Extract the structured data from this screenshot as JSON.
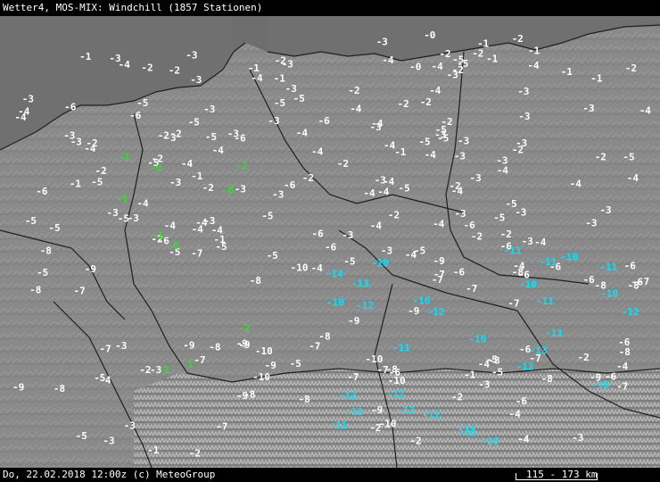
{
  "header": {
    "title": "Wetter4, MOS-MIX: Windchill (1857 Stationen)"
  },
  "footer": {
    "timestamp": "Do, 22.02.2018 12:00z (c) MeteoGroup",
    "scale": "115 - 173 km"
  },
  "colors": {
    "default_value": "#ffffff",
    "cyan_value": "#00e5ff",
    "green_value": "#33dd33",
    "land": "#8a8a8a",
    "sea": "#6e6e6e",
    "border": "#222222"
  },
  "stations_note_free": true,
  "stations": [
    {
      "v": "-0",
      "c": "w"
    },
    {
      "v": "-0",
      "c": "w"
    },
    {
      "v": "-2",
      "c": "w"
    },
    {
      "v": "-4",
      "c": "w"
    },
    {
      "v": "-5",
      "c": "w"
    },
    {
      "v": "-1",
      "c": "w"
    },
    {
      "v": "-2",
      "c": "w"
    },
    {
      "v": "-3",
      "c": "w"
    },
    {
      "v": "-2",
      "c": "w"
    },
    {
      "v": "-1",
      "c": "w"
    },
    {
      "v": "-1",
      "c": "w"
    },
    {
      "v": "-2",
      "c": "w"
    },
    {
      "v": "-3",
      "c": "w"
    },
    {
      "v": "-1",
      "c": "w"
    },
    {
      "v": "-2",
      "c": "w"
    },
    {
      "v": "-1",
      "c": "w"
    },
    {
      "v": "-3",
      "c": "w"
    },
    {
      "v": "-1",
      "c": "w"
    },
    {
      "v": "-2",
      "c": "w"
    },
    {
      "v": "-1",
      "c": "w"
    },
    {
      "v": "-3",
      "c": "w"
    },
    {
      "v": "-4",
      "c": "w"
    },
    {
      "v": "-2",
      "c": "w"
    },
    {
      "v": "-5",
      "c": "w"
    },
    {
      "v": "-4",
      "c": "w"
    },
    {
      "v": "-3",
      "c": "w"
    },
    {
      "v": "-2",
      "c": "w"
    },
    {
      "v": "-4",
      "c": "w"
    },
    {
      "v": "-5",
      "c": "w"
    },
    {
      "v": "-3",
      "c": "w"
    },
    {
      "v": "-2",
      "c": "w"
    },
    {
      "v": "-4",
      "c": "w"
    },
    {
      "v": "-3",
      "c": "w"
    },
    {
      "v": "-1",
      "c": "w"
    },
    {
      "v": "-3",
      "c": "w"
    },
    {
      "v": "-4",
      "c": "w"
    },
    {
      "v": "-2",
      "c": "w"
    },
    {
      "v": "-3",
      "c": "w"
    },
    {
      "v": "-5",
      "c": "w"
    },
    {
      "v": "-4",
      "c": "w"
    },
    {
      "v": "-6",
      "c": "w"
    },
    {
      "v": "-5",
      "c": "w"
    },
    {
      "v": "-3",
      "c": "w"
    },
    {
      "v": "-4",
      "c": "w"
    },
    {
      "v": "-2",
      "c": "w"
    },
    {
      "v": "-3",
      "c": "w"
    },
    {
      "v": "-5",
      "c": "w"
    },
    {
      "v": "-4",
      "c": "w"
    },
    {
      "v": "-6",
      "c": "w"
    },
    {
      "v": "-5",
      "c": "w"
    },
    {
      "v": "-4",
      "c": "w"
    },
    {
      "v": "-3",
      "c": "w"
    },
    {
      "v": "-6",
      "c": "w"
    },
    {
      "v": "-4",
      "c": "w"
    },
    {
      "v": "-5",
      "c": "w"
    },
    {
      "v": "-2",
      "c": "w"
    },
    {
      "v": "-3",
      "c": "w"
    },
    {
      "v": "-4",
      "c": "w"
    },
    {
      "v": "-3",
      "c": "w"
    },
    {
      "v": "-2",
      "c": "w"
    },
    {
      "v": "-4",
      "c": "w"
    },
    {
      "v": "-3",
      "c": "w"
    },
    {
      "v": "-2",
      "c": "w"
    },
    {
      "v": "-5",
      "c": "w"
    },
    {
      "v": "-3",
      "c": "w"
    },
    {
      "v": "-4",
      "c": "w"
    },
    {
      "v": "-2",
      "c": "w"
    },
    {
      "v": "-3",
      "c": "w"
    },
    {
      "v": "-5",
      "c": "w"
    },
    {
      "v": "-4",
      "c": "w"
    },
    {
      "v": "-6",
      "c": "w"
    },
    {
      "v": "-3",
      "c": "w"
    },
    {
      "v": "-4",
      "c": "w"
    },
    {
      "v": "-5",
      "c": "w"
    },
    {
      "v": "-2",
      "c": "w"
    },
    {
      "v": "-3",
      "c": "w"
    },
    {
      "v": "-4",
      "c": "w"
    },
    {
      "v": "-2",
      "c": "w"
    },
    {
      "v": "-3",
      "c": "w"
    },
    {
      "v": "-1",
      "c": "w"
    },
    {
      "v": "-3",
      "c": "w"
    },
    {
      "v": "-2",
      "c": "w"
    },
    {
      "v": "-4",
      "c": "w"
    },
    {
      "v": "-3",
      "c": "w"
    },
    {
      "v": "-5",
      "c": "w"
    },
    {
      "v": "-2",
      "c": "w"
    },
    {
      "v": "-1",
      "c": "w"
    },
    {
      "v": "-3",
      "c": "w"
    },
    {
      "v": "-2",
      "c": "w"
    },
    {
      "v": "-4",
      "c": "w"
    },
    {
      "v": "-3",
      "c": "w"
    },
    {
      "v": "-2",
      "c": "w"
    },
    {
      "v": "-1",
      "c": "w"
    },
    {
      "v": "-3",
      "c": "w"
    },
    {
      "v": "-2",
      "c": "w"
    },
    {
      "v": "-4",
      "c": "w"
    },
    {
      "v": "-3",
      "c": "w"
    },
    {
      "v": "-5",
      "c": "w"
    },
    {
      "v": "-2",
      "c": "w"
    },
    {
      "v": "-4",
      "c": "w"
    },
    {
      "v": "-3",
      "c": "w"
    },
    {
      "v": "-6",
      "c": "w"
    },
    {
      "v": "-4",
      "c": "w"
    },
    {
      "v": "-3",
      "c": "w"
    },
    {
      "v": "-5",
      "c": "w"
    },
    {
      "v": "-4",
      "c": "w"
    },
    {
      "v": "-6",
      "c": "w"
    },
    {
      "v": "-5",
      "c": "w"
    },
    {
      "v": "-4",
      "c": "w"
    },
    {
      "v": "-3",
      "c": "w"
    },
    {
      "v": "-5",
      "c": "w"
    },
    {
      "v": "-4",
      "c": "w"
    },
    {
      "v": "-6",
      "c": "w"
    },
    {
      "v": "-5",
      "c": "w"
    },
    {
      "v": "-4",
      "c": "w"
    },
    {
      "v": "-3",
      "c": "w"
    },
    {
      "v": "-2",
      "c": "w"
    },
    {
      "v": "-4",
      "c": "w"
    },
    {
      "v": "-3",
      "c": "w"
    },
    {
      "v": "-5",
      "c": "w"
    },
    {
      "v": "-4",
      "c": "w"
    },
    {
      "v": "-2",
      "c": "w"
    },
    {
      "v": "-3",
      "c": "w"
    },
    {
      "v": "-4",
      "c": "w"
    },
    {
      "v": "-2",
      "c": "w"
    },
    {
      "v": "-3",
      "c": "w"
    },
    {
      "v": "-1",
      "c": "w"
    },
    {
      "v": "-2",
      "c": "w"
    },
    {
      "v": "-3",
      "c": "w"
    },
    {
      "v": "-4",
      "c": "w"
    },
    {
      "v": "-5",
      "c": "w"
    },
    {
      "v": "-3",
      "c": "w"
    },
    {
      "v": "-4",
      "c": "w"
    },
    {
      "v": "-6",
      "c": "w"
    },
    {
      "v": "-5",
      "c": "w"
    },
    {
      "v": "-4",
      "c": "w"
    },
    {
      "v": "-3",
      "c": "w"
    },
    {
      "v": "-5",
      "c": "w"
    },
    {
      "v": "-6",
      "c": "w"
    },
    {
      "v": "-4",
      "c": "w"
    },
    {
      "v": "-3",
      "c": "w"
    },
    {
      "v": "-5",
      "c": "w"
    },
    {
      "v": "-4",
      "c": "w"
    },
    {
      "v": "-3",
      "c": "w"
    },
    {
      "v": "-6",
      "c": "w"
    },
    {
      "v": "-5",
      "c": "w"
    },
    {
      "v": "-4",
      "c": "w"
    },
    {
      "v": "-6",
      "c": "w"
    },
    {
      "v": "-7",
      "c": "w"
    },
    {
      "v": "-5",
      "c": "w"
    },
    {
      "v": "-6",
      "c": "w"
    },
    {
      "v": "-4",
      "c": "w"
    },
    {
      "v": "-5",
      "c": "w"
    },
    {
      "v": "-6",
      "c": "w"
    },
    {
      "v": "-7",
      "c": "w"
    },
    {
      "v": "-8",
      "c": "w"
    },
    {
      "v": "-6",
      "c": "w"
    },
    {
      "v": "-5",
      "c": "w"
    },
    {
      "v": "-7",
      "c": "w"
    },
    {
      "v": "-6",
      "c": "w"
    },
    {
      "v": "-8",
      "c": "w"
    },
    {
      "v": "-7",
      "c": "w"
    },
    {
      "v": "-6",
      "c": "w"
    },
    {
      "v": "-9",
      "c": "w"
    },
    {
      "v": "-8",
      "c": "w"
    },
    {
      "v": "-7",
      "c": "w"
    },
    {
      "v": "-6",
      "c": "w"
    },
    {
      "v": "-8",
      "c": "w"
    },
    {
      "v": "-9",
      "c": "w"
    },
    {
      "v": "-7",
      "c": "w"
    },
    {
      "v": "-10",
      "c": "w"
    },
    {
      "v": "-8",
      "c": "w"
    },
    {
      "v": "-9",
      "c": "w"
    },
    {
      "v": "-7",
      "c": "w"
    },
    {
      "v": "-8",
      "c": "w"
    },
    {
      "v": "-10",
      "c": "c"
    },
    {
      "v": "-11",
      "c": "c"
    },
    {
      "v": "-12",
      "c": "c"
    },
    {
      "v": "-11",
      "c": "c"
    },
    {
      "v": "-10",
      "c": "c"
    },
    {
      "v": "-12",
      "c": "c"
    },
    {
      "v": "-11",
      "c": "c"
    },
    {
      "v": "-10",
      "c": "c"
    },
    {
      "v": "-13",
      "c": "c"
    },
    {
      "v": "-12",
      "c": "c"
    },
    {
      "v": "-11",
      "c": "c"
    },
    {
      "v": "-10",
      "c": "c"
    },
    {
      "v": "-12",
      "c": "c"
    },
    {
      "v": "-11",
      "c": "c"
    },
    {
      "v": "-14",
      "c": "c"
    },
    {
      "v": "-12",
      "c": "c"
    },
    {
      "v": "-10",
      "c": "c"
    },
    {
      "v": "-11",
      "c": "c"
    },
    {
      "v": "-13",
      "c": "c"
    },
    {
      "v": "-10",
      "c": "c"
    },
    {
      "v": "-1",
      "c": "g"
    },
    {
      "v": "-0",
      "c": "g"
    },
    {
      "v": "-1",
      "c": "g"
    },
    {
      "v": "-2",
      "c": "g"
    },
    {
      "v": "-1",
      "c": "g"
    },
    {
      "v": "-0",
      "c": "g"
    },
    {
      "v": "-1",
      "c": "g"
    },
    {
      "v": "-2",
      "c": "g"
    },
    {
      "v": "-1",
      "c": "g"
    },
    {
      "v": "-0",
      "c": "g"
    },
    {
      "v": "-9",
      "c": "w"
    },
    {
      "v": "-8",
      "c": "w"
    },
    {
      "v": "-7",
      "c": "w"
    },
    {
      "v": "-9",
      "c": "w"
    },
    {
      "v": "-10",
      "c": "w"
    },
    {
      "v": "-8",
      "c": "w"
    },
    {
      "v": "-9",
      "c": "w"
    },
    {
      "v": "-7",
      "c": "w"
    },
    {
      "v": "-8",
      "c": "w"
    },
    {
      "v": "-6",
      "c": "w"
    },
    {
      "v": "-9",
      "c": "w"
    },
    {
      "v": "-8",
      "c": "w"
    },
    {
      "v": "-10",
      "c": "w"
    },
    {
      "v": "-7",
      "c": "w"
    },
    {
      "v": "-9",
      "c": "w"
    },
    {
      "v": "-6",
      "c": "w"
    },
    {
      "v": "-8",
      "c": "w"
    },
    {
      "v": "-7",
      "c": "w"
    },
    {
      "v": "-5",
      "c": "w"
    },
    {
      "v": "-9",
      "c": "w"
    },
    {
      "v": "-4",
      "c": "w"
    },
    {
      "v": "-3",
      "c": "w"
    },
    {
      "v": "-5",
      "c": "w"
    },
    {
      "v": "-2",
      "c": "w"
    },
    {
      "v": "-4",
      "c": "w"
    },
    {
      "v": "-3",
      "c": "w"
    },
    {
      "v": "-2",
      "c": "w"
    },
    {
      "v": "-1",
      "c": "w"
    },
    {
      "v": "-3",
      "c": "w"
    },
    {
      "v": "-2",
      "c": "w"
    },
    {
      "v": "-5",
      "c": "w"
    },
    {
      "v": "-4",
      "c": "w"
    },
    {
      "v": "-6",
      "c": "w"
    },
    {
      "v": "-5",
      "c": "w"
    },
    {
      "v": "-7",
      "c": "w"
    },
    {
      "v": "-6",
      "c": "w"
    },
    {
      "v": "-8",
      "c": "w"
    },
    {
      "v": "-7",
      "c": "w"
    },
    {
      "v": "-6",
      "c": "w"
    },
    {
      "v": "-9",
      "c": "w"
    },
    {
      "v": "-10",
      "c": "w"
    },
    {
      "v": "-8",
      "c": "w"
    },
    {
      "v": "-9",
      "c": "w"
    },
    {
      "v": "-7",
      "c": "w"
    },
    {
      "v": "-8",
      "c": "w"
    },
    {
      "v": "-10",
      "c": "w"
    },
    {
      "v": "-9",
      "c": "w"
    },
    {
      "v": "-8",
      "c": "w"
    },
    {
      "v": "-7",
      "c": "w"
    },
    {
      "v": "-10",
      "c": "w"
    },
    {
      "v": "-11",
      "c": "c"
    },
    {
      "v": "-12",
      "c": "c"
    },
    {
      "v": "-10",
      "c": "c"
    },
    {
      "v": "-11",
      "c": "c"
    },
    {
      "v": "-12",
      "c": "c"
    },
    {
      "v": "-10",
      "c": "c"
    },
    {
      "v": "-13",
      "c": "c"
    },
    {
      "v": "-11",
      "c": "c"
    },
    {
      "v": "-12",
      "c": "c"
    },
    {
      "v": "-10",
      "c": "c"
    },
    {
      "v": "-3",
      "c": "w"
    },
    {
      "v": "-4",
      "c": "w"
    },
    {
      "v": "-2",
      "c": "w"
    },
    {
      "v": "-3",
      "c": "w"
    },
    {
      "v": "-5",
      "c": "w"
    },
    {
      "v": "-4",
      "c": "w"
    },
    {
      "v": "-2",
      "c": "w"
    },
    {
      "v": "-3",
      "c": "w"
    },
    {
      "v": "-1",
      "c": "w"
    },
    {
      "v": "-2",
      "c": "w"
    }
  ]
}
